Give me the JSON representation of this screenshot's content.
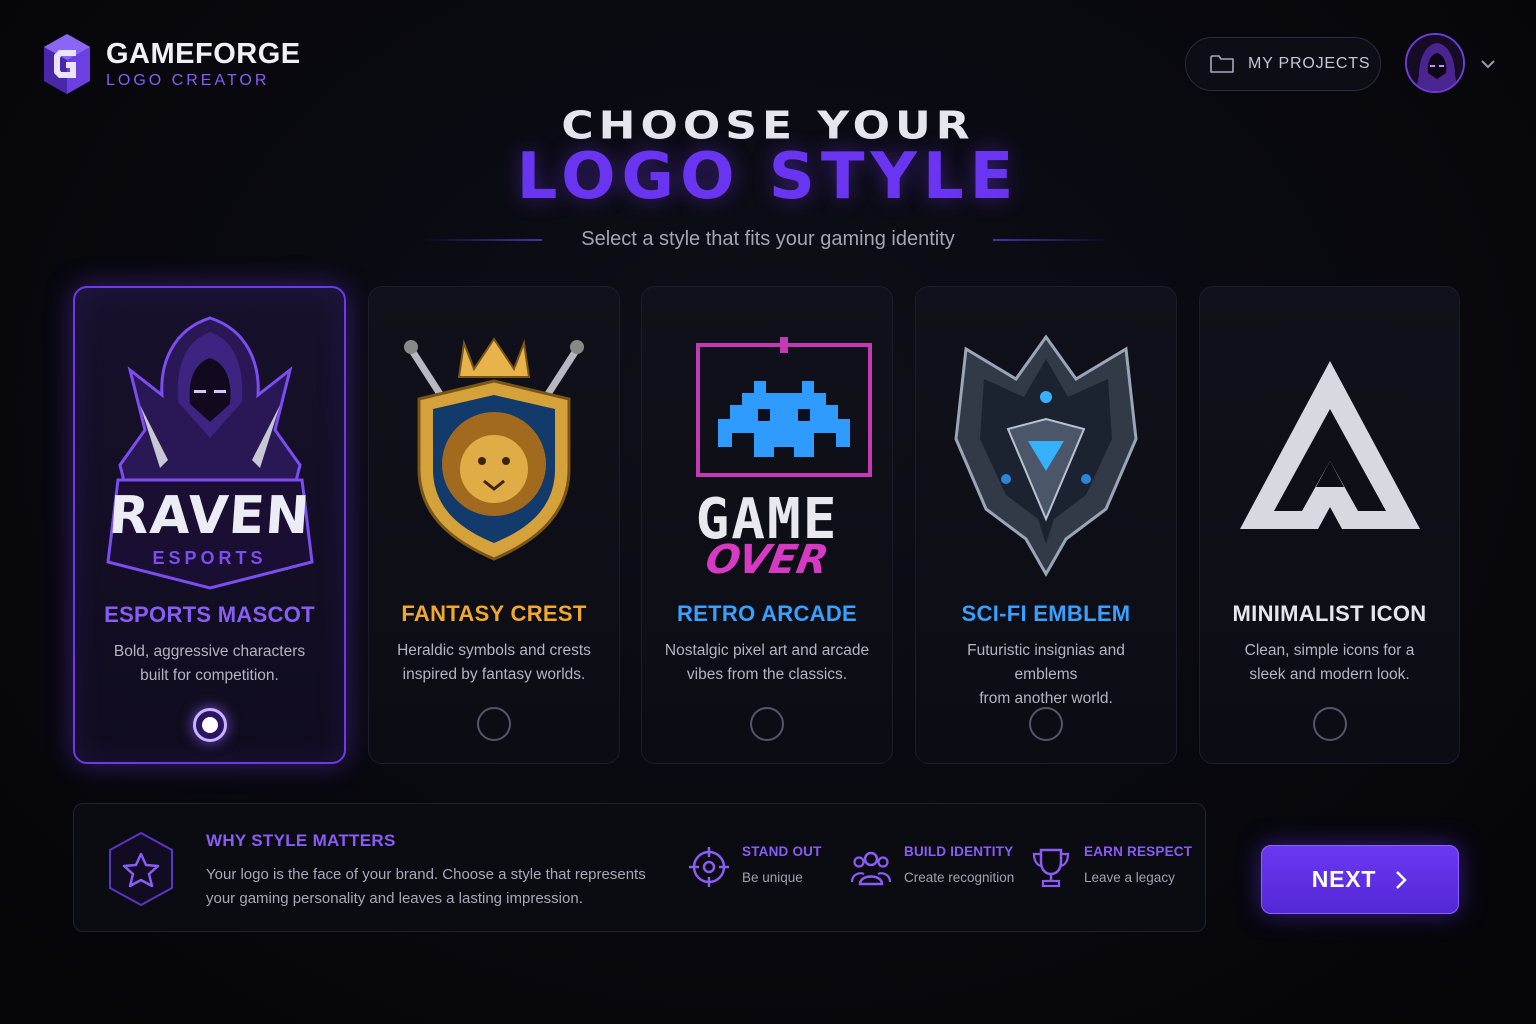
{
  "brand": {
    "title": "GAMEFORGE",
    "subtitle": "LOGO CREATOR",
    "mark_icon": "gameforge-g-logo-icon"
  },
  "header": {
    "projects_label": "MY PROJECTS",
    "projects_icon": "folder-icon",
    "avatar_icon": "hooded-avatar",
    "caret_icon": "chevron-down-icon"
  },
  "hero": {
    "line1": "CHOOSE YOUR",
    "line2": "LOGO STYLE",
    "subtitle": "Select a style that fits your gaming identity"
  },
  "styles": [
    {
      "title": "ESPORTS MASCOT",
      "desc": "Bold, aggressive characters\nbuilt for competition.",
      "color": "#8a5cf6",
      "selected": true,
      "art_text": "RAVEN",
      "art_subtext": "ESPORTS"
    },
    {
      "title": "FANTASY CREST",
      "desc": "Heraldic symbols and crests\ninspired by fantasy worlds.",
      "color": "#f0a92e",
      "selected": false
    },
    {
      "title": "RETRO ARCADE",
      "desc": "Nostalgic pixel art and arcade\nvibes from the classics.",
      "color": "#3aa0ff",
      "selected": false,
      "art_text": "GAME",
      "art_subtext": "OVER"
    },
    {
      "title": "SCI-FI EMBLEM",
      "desc": "Futuristic insignias and emblems\nfrom another world.",
      "color": "#3aa0ff",
      "selected": false
    },
    {
      "title": "MINIMALIST ICON",
      "desc": "Clean, simple icons for a\nsleek and modern look.",
      "color": "#e6e6ee",
      "selected": false
    }
  ],
  "info": {
    "title": "WHY STYLE MATTERS",
    "desc": "Your logo is the face of your brand. Choose a style that represents your gaming personality and leaves a lasting impression.",
    "features": [
      {
        "title": "STAND OUT",
        "desc": "Be unique",
        "icon": "crosshair-icon"
      },
      {
        "title": "BUILD IDENTITY",
        "desc": "Create recognition",
        "icon": "group-icon"
      },
      {
        "title": "EARN RESPECT",
        "desc": "Leave a legacy",
        "icon": "trophy-icon"
      }
    ]
  },
  "next": {
    "label": "NEXT"
  },
  "colors": {
    "accent": "#6a35f0",
    "background": "#07070c"
  }
}
